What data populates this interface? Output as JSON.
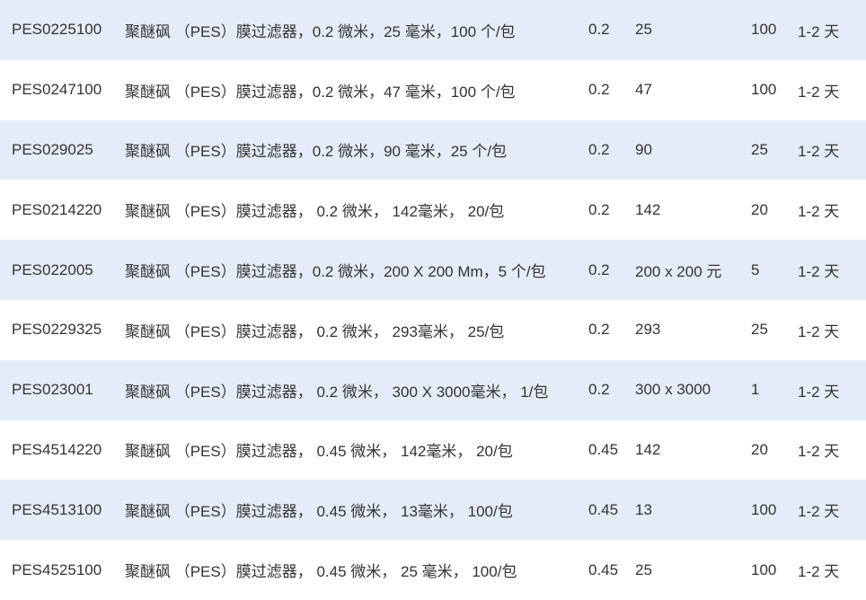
{
  "rows": [
    {
      "sku": "PES0225100",
      "desc": "聚醚砜 （PES）膜过滤器，0.2 微米，25 毫米，100 个/包",
      "pore": "0.2",
      "size": "25",
      "qty": "100",
      "ship": "1-2 天"
    },
    {
      "sku": "PES0247100",
      "desc": "聚醚砜 （PES）膜过滤器，0.2 微米，47 毫米，100 个/包",
      "pore": "0.2",
      "size": "47",
      "qty": "100",
      "ship": "1-2 天"
    },
    {
      "sku": "PES029025",
      "desc": "聚醚砜 （PES）膜过滤器，0.2 微米，90 毫米，25 个/包",
      "pore": "0.2",
      "size": "90",
      "qty": "25",
      "ship": "1-2 天"
    },
    {
      "sku": "PES0214220",
      "desc": "聚醚砜 （PES）膜过滤器， 0.2 微米， 142毫米， 20/包",
      "pore": "0.2",
      "size": "142",
      "qty": "20",
      "ship": "1-2 天"
    },
    {
      "sku": "PES022005",
      "desc": "聚醚砜 （PES）膜过滤器，0.2 微米，200 X 200 Mm，5 个/包",
      "pore": "0.2",
      "size": "200 x 200 元",
      "qty": "5",
      "ship": "1-2 天"
    },
    {
      "sku": "PES0229325",
      "desc": "聚醚砜 （PES）膜过滤器， 0.2 微米， 293毫米， 25/包",
      "pore": "0.2",
      "size": "293",
      "qty": "25",
      "ship": "1-2 天"
    },
    {
      "sku": "PES023001",
      "desc": "聚醚砜 （PES）膜过滤器， 0.2 微米， 300 X 3000毫米， 1/包",
      "pore": "0.2",
      "size": "300 x 3000",
      "qty": "1",
      "ship": "1-2 天"
    },
    {
      "sku": "PES4514220",
      "desc": "聚醚砜 （PES）膜过滤器， 0.45 微米， 142毫米， 20/包",
      "pore": "0.45",
      "size": "142",
      "qty": "20",
      "ship": "1-2 天"
    },
    {
      "sku": "PES4513100",
      "desc": "聚醚砜 （PES）膜过滤器， 0.45 微米， 13毫米， 100/包",
      "pore": "0.45",
      "size": "13",
      "qty": "100",
      "ship": "1-2 天"
    },
    {
      "sku": "PES4525100",
      "desc": "聚醚砜 （PES）膜过滤器， 0.45 微米， 25 毫米， 100/包",
      "pore": "0.45",
      "size": "25",
      "qty": "100",
      "ship": "1-2 天"
    }
  ]
}
